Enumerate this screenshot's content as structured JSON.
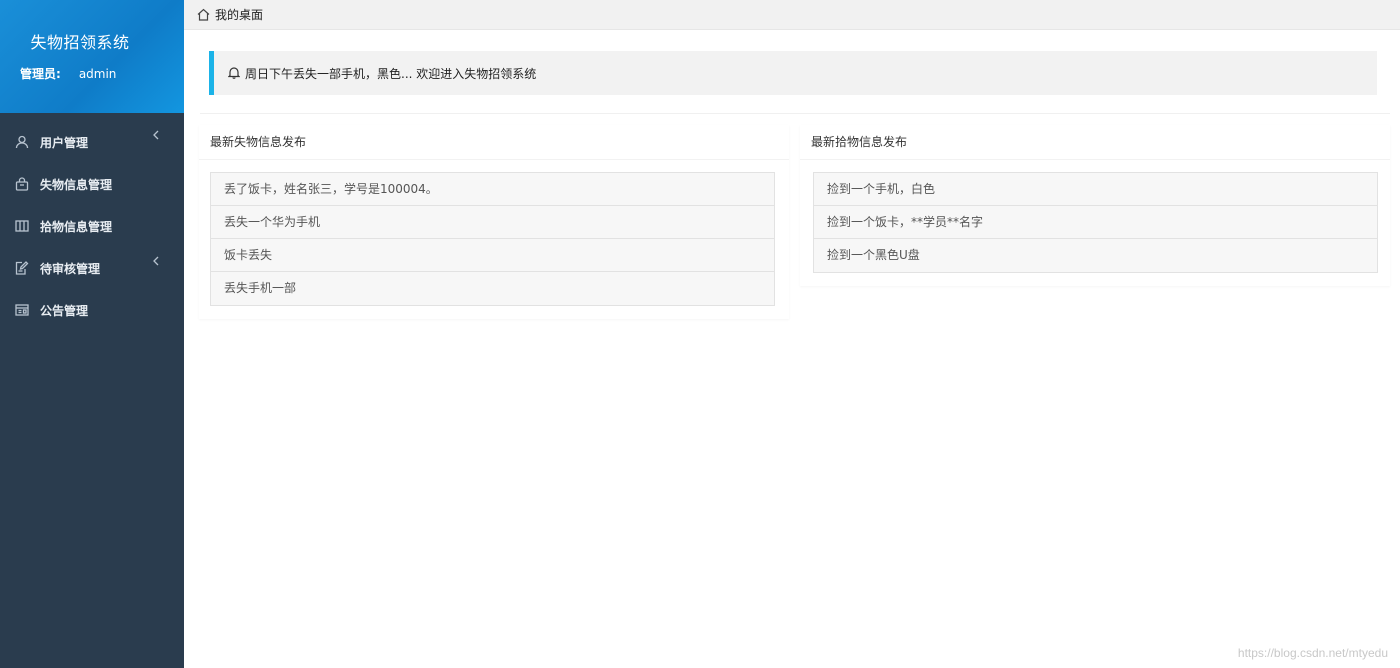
{
  "app": {
    "title": "失物招领系统",
    "admin_label": "管理员:",
    "admin_name": "admin"
  },
  "sidebar": {
    "items": [
      {
        "label": "用户管理",
        "icon": "user-icon",
        "has_arrow": true
      },
      {
        "label": "失物信息管理",
        "icon": "bag-icon",
        "has_arrow": false
      },
      {
        "label": "拾物信息管理",
        "icon": "columns-icon",
        "has_arrow": false
      },
      {
        "label": "待审核管理",
        "icon": "edit-doc-icon",
        "has_arrow": true
      },
      {
        "label": "公告管理",
        "icon": "notice-board-icon",
        "has_arrow": false
      }
    ]
  },
  "breadcrumb": {
    "icon": "home-icon",
    "label": "我的桌面"
  },
  "notice": {
    "icon": "bell-icon",
    "text": "周日下午丢失一部手机，黑色... 欢迎进入失物招领系统"
  },
  "lost_panel": {
    "title": "最新失物信息发布",
    "items": [
      "丢了饭卡，姓名张三，学号是100004。",
      "丢失一个华为手机",
      "饭卡丢失",
      "丢失手机一部"
    ]
  },
  "found_panel": {
    "title": "最新拾物信息发布",
    "items": [
      "捡到一个手机，白色",
      "捡到一个饭卡，**学员**名字",
      "捡到一个黑色U盘"
    ]
  },
  "watermark": "https://blog.csdn.net/mtyedu",
  "colors": {
    "sidebar_bg": "#2a3c4e",
    "header_blue": "#1a8fd8",
    "notice_accent": "#1bb3e8"
  }
}
